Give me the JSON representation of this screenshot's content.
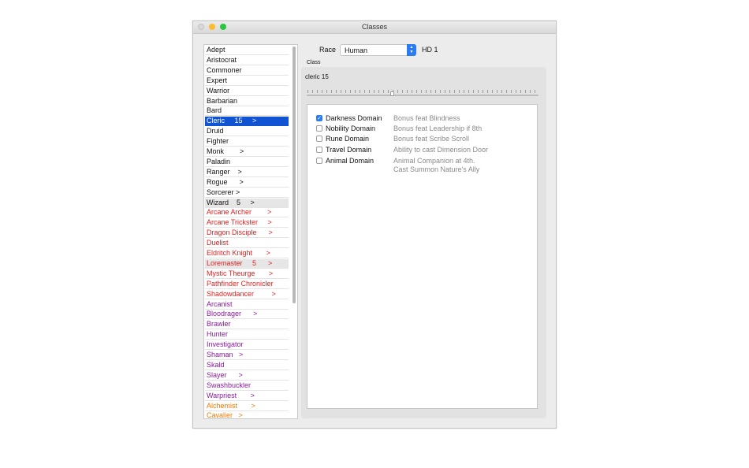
{
  "window": {
    "title": "Classes"
  },
  "class_list": [
    {
      "label": "Adept",
      "color": "#111111"
    },
    {
      "label": "Aristocrat",
      "color": "#111111"
    },
    {
      "label": "Commoner",
      "color": "#111111"
    },
    {
      "label": "Expert",
      "color": "#111111"
    },
    {
      "label": "Warrior",
      "color": "#111111"
    },
    {
      "label": "Barbarian",
      "color": "#111111"
    },
    {
      "label": "Bard",
      "color": "#111111"
    },
    {
      "label": "Cleric     15     >",
      "color": "#ffffff",
      "state": "selected"
    },
    {
      "label": "Druid",
      "color": "#111111"
    },
    {
      "label": "Fighter",
      "color": "#111111"
    },
    {
      "label": "Monk        >",
      "color": "#111111"
    },
    {
      "label": "Paladin",
      "color": "#111111"
    },
    {
      "label": "Ranger    >",
      "color": "#111111"
    },
    {
      "label": "Rogue      >",
      "color": "#111111"
    },
    {
      "label": "Sorcerer >",
      "color": "#111111"
    },
    {
      "label": "Wizard    5     >",
      "color": "#111111",
      "state": "highlight"
    },
    {
      "label": "Arcane Archer        >",
      "color": "#e02020"
    },
    {
      "label": "Arcane Trickster     >",
      "color": "#e02020"
    },
    {
      "label": "Dragon Disciple      >",
      "color": "#e02020"
    },
    {
      "label": "Duelist",
      "color": "#e02020"
    },
    {
      "label": "Eldritch Knight       >",
      "color": "#e02020"
    },
    {
      "label": "Loremaster     5      >",
      "color": "#e02020",
      "state": "highlight"
    },
    {
      "label": "Mystic Theurge       >",
      "color": "#e02020"
    },
    {
      "label": "Pathfinder Chronicler",
      "color": "#e02020"
    },
    {
      "label": "Shadowdancer         >",
      "color": "#e02020"
    },
    {
      "label": "Arcanist",
      "color": "#8a1a9b"
    },
    {
      "label": "Bloodrager      >",
      "color": "#8a1a9b"
    },
    {
      "label": "Brawler",
      "color": "#8a1a9b"
    },
    {
      "label": "Hunter",
      "color": "#8a1a9b"
    },
    {
      "label": "Investigator",
      "color": "#8a1a9b"
    },
    {
      "label": "Shaman   >",
      "color": "#8a1a9b"
    },
    {
      "label": "Skald",
      "color": "#8a1a9b"
    },
    {
      "label": "Slayer      >",
      "color": "#8a1a9b"
    },
    {
      "label": "Swashbuckler",
      "color": "#8a1a9b"
    },
    {
      "label": "Warpriest       >",
      "color": "#8a1a9b"
    },
    {
      "label": "Alchemist       >",
      "color": "#f07800"
    },
    {
      "label": "Cavalier   >",
      "color": "#f07800"
    }
  ],
  "race": {
    "label": "Race",
    "value": "Human",
    "hd": "HD 1"
  },
  "class_group": {
    "label": "Class",
    "level_text": "cleric 15",
    "slider_value": 15
  },
  "domains": [
    {
      "name": "Darkness Domain",
      "checked": true,
      "desc": "Bonus feat Blindness"
    },
    {
      "name": "Nobility Domain",
      "checked": false,
      "desc": "Bonus feat Leadership if 8th"
    },
    {
      "name": "Rune Domain",
      "checked": false,
      "desc": "Bonus feat Scribe Scroll"
    },
    {
      "name": "Travel Domain",
      "checked": false,
      "desc": "Ability to cast Dimension Door"
    },
    {
      "name": "Animal Domain",
      "checked": false,
      "desc": "Animal Companion at 4th.\nCast Summon Nature's Ally"
    }
  ],
  "icons": {
    "checkmark": "checkmark-icon",
    "select_arrows": "updown-chevron-icon"
  }
}
